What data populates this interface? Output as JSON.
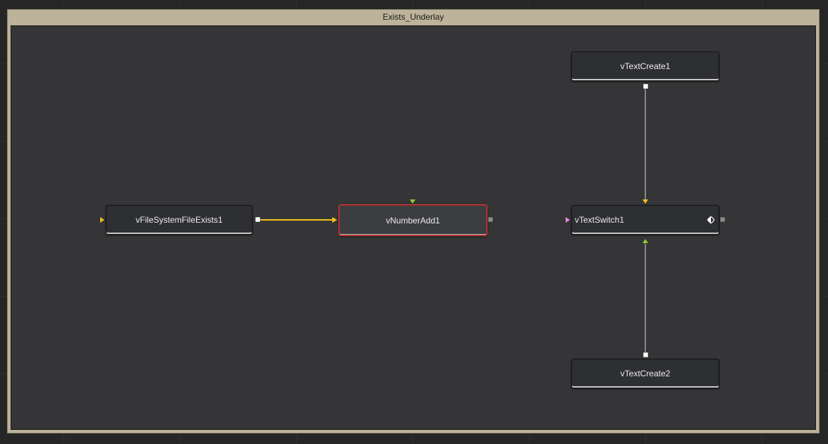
{
  "underlay": {
    "title": "Exists_Underlay"
  },
  "nodes": {
    "file_exists": {
      "label": "vFileSystemFileExists1"
    },
    "number_add": {
      "label": "vNumberAdd1"
    },
    "text_create1": {
      "label": "vTextCreate1"
    },
    "text_switch": {
      "label": "vTextSwitch1"
    },
    "text_create2": {
      "label": "vTextCreate2"
    }
  },
  "colors": {
    "workspace": "#262626",
    "underlay_frame": "#bdb39a",
    "underlay_area": "#353537",
    "node_body": "#2e2f33",
    "selection_outline": "#e23b3b",
    "wire_main": "#f2c21a",
    "wire_plain": "#d8d8d8",
    "input_yellow": "#f2c21a",
    "input_green": "#8fcf2a",
    "input_magenta": "#e486e4"
  }
}
